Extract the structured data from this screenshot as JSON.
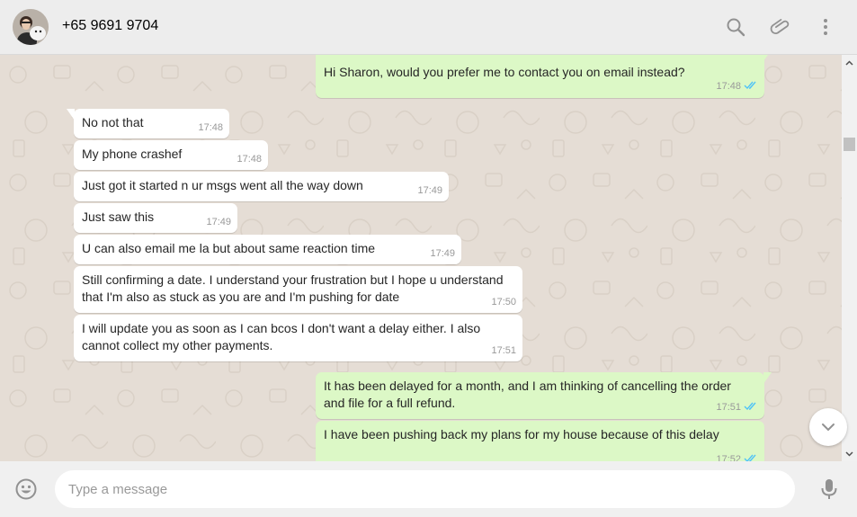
{
  "header": {
    "contact_name": "+65 9691 9704",
    "icons": [
      "search-icon",
      "attach-icon",
      "menu-icon"
    ]
  },
  "messages": [
    {
      "direction": "out",
      "text": "Hi Sharon, would you prefer me to contact you on email instead?",
      "time": "17:48",
      "status": "read"
    },
    {
      "direction": "in",
      "text": "No not that",
      "time": "17:48"
    },
    {
      "direction": "in",
      "text": "My phone crashef",
      "time": "17:48"
    },
    {
      "direction": "in",
      "text": "Just got it started n ur msgs went all the way down",
      "time": "17:49"
    },
    {
      "direction": "in",
      "text": "Just saw this",
      "time": "17:49"
    },
    {
      "direction": "in",
      "text": "U can also email me la but about same reaction time",
      "time": "17:49"
    },
    {
      "direction": "in",
      "text": "Still confirming a date. I understand your frustration but I hope u understand that I'm also as stuck as you are and I'm pushing for date",
      "time": "17:50"
    },
    {
      "direction": "in",
      "text": "I will update you as soon as I can bcos I don't want a delay either. I also cannot collect my other payments.",
      "time": "17:51"
    },
    {
      "direction": "out",
      "text": "It has been delayed for a month, and I am thinking of cancelling the order and file for a full refund.",
      "time": "17:51",
      "status": "read"
    },
    {
      "direction": "out",
      "text": "I have been pushing back my plans for my house because of this delay",
      "time": "17:52",
      "status": "read"
    }
  ],
  "composer": {
    "placeholder": "Type a message"
  },
  "colors": {
    "outgoing_bubble": "#dcf8c6",
    "incoming_bubble": "#ffffff",
    "read_ticks": "#4fc3f7",
    "chat_background": "#e5ddd5"
  }
}
